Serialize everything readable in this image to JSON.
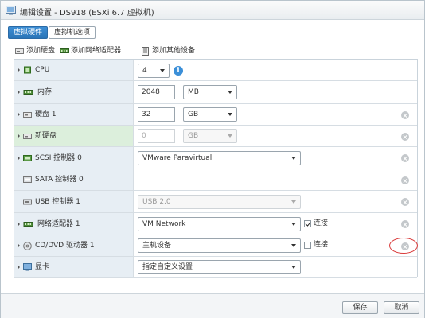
{
  "window": {
    "title": "编辑设置 - DS918 (ESXi 6.7 虚拟机)"
  },
  "tabs": [
    {
      "label": "虚拟硬件",
      "active": true
    },
    {
      "label": "虚拟机选项",
      "active": false
    }
  ],
  "toolbar": {
    "add_disk": "添加硬盘",
    "add_nic": "添加网络适配器",
    "add_other": "添加其他设备"
  },
  "devices": {
    "cpu": {
      "label": "CPU",
      "value": "4"
    },
    "memory": {
      "label": "内存",
      "value": "2048",
      "unit": "MB"
    },
    "disk1": {
      "label": "硬盘 1",
      "value": "32",
      "unit": "GB"
    },
    "newdisk": {
      "label": "新硬盘",
      "value": "0",
      "unit": "GB"
    },
    "scsi": {
      "label": "SCSI 控制器 0",
      "value": "VMware Paravirtual"
    },
    "sata": {
      "label": "SATA 控制器 0"
    },
    "usb": {
      "label": "USB 控制器 1",
      "value": "USB 2.0"
    },
    "nic": {
      "label": "网络适配器 1",
      "value": "VM Network",
      "connect_label": "连接",
      "connected": true
    },
    "cdrom": {
      "label": "CD/DVD 驱动器 1",
      "value": "主机设备",
      "connect_label": "连接",
      "connected": false
    },
    "video": {
      "label": "显卡",
      "value": "指定自定义设置"
    }
  },
  "footer": {
    "save": "保存",
    "cancel": "取消"
  },
  "colors": {
    "accent": "#2a74b7",
    "highlight": "#d93a3a",
    "info": "#3b8fd8"
  }
}
